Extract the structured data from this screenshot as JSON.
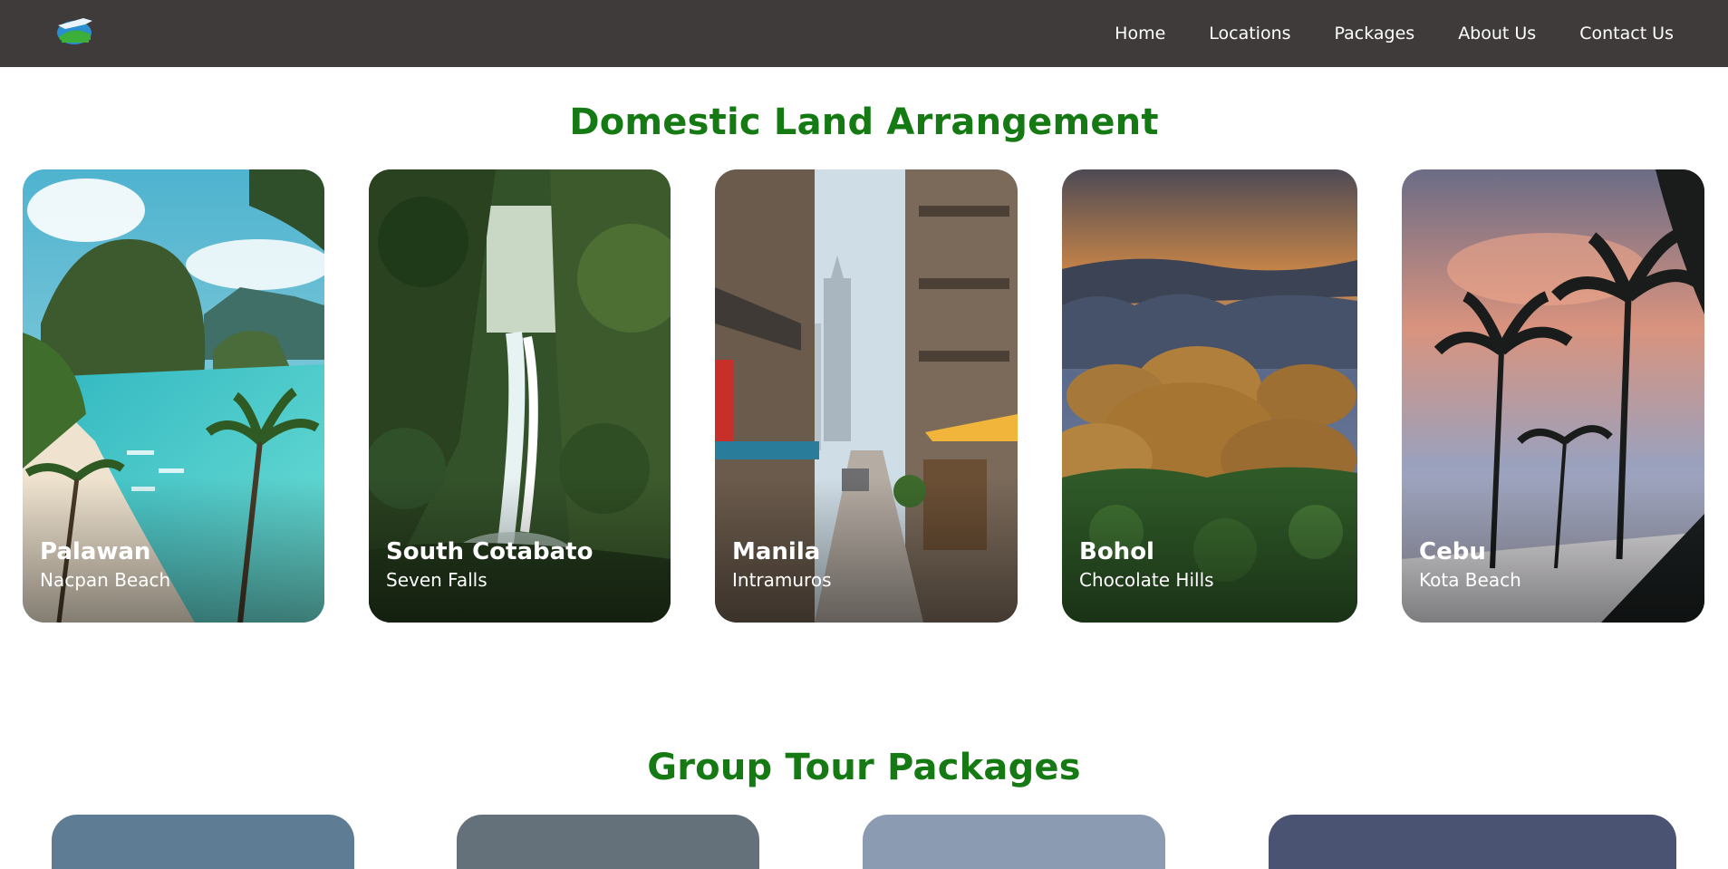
{
  "nav": {
    "logo_icon": "airplane-globe-logo",
    "links": [
      "Home",
      "Locations",
      "Packages",
      "About Us",
      "Contact Us"
    ]
  },
  "section_domestic": {
    "title": "Domestic Land Arrangement",
    "cards": [
      {
        "name": "Palawan",
        "spot": "Nacpan Beach",
        "scene": "lagoon-beach"
      },
      {
        "name": "South Cotabato",
        "spot": "Seven Falls",
        "scene": "jungle-waterfall"
      },
      {
        "name": "Manila",
        "spot": "Intramuros",
        "scene": "city-street"
      },
      {
        "name": "Bohol",
        "spot": "Chocolate Hills",
        "scene": "hills-sunset"
      },
      {
        "name": "Cebu",
        "spot": "Kota Beach",
        "scene": "palm-sunset"
      }
    ]
  },
  "section_group": {
    "title": "Group Tour Packages"
  },
  "colors": {
    "navbar": "#3f3b3a",
    "heading": "#157a13",
    "background": "#ffffff"
  }
}
